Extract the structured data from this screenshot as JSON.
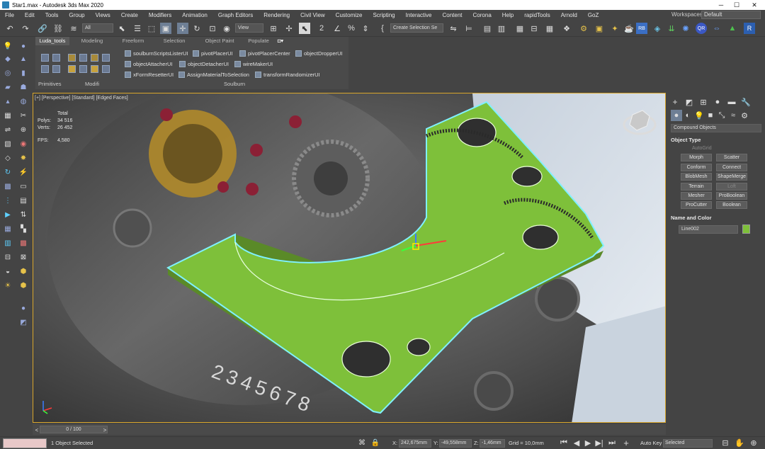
{
  "window": {
    "title": "Star1.max - Autodesk 3ds Max 2020",
    "minimize": "─",
    "maximize": "☐",
    "close": "✕"
  },
  "menu": [
    "File",
    "Edit",
    "Tools",
    "Group",
    "Views",
    "Create",
    "Modifiers",
    "Animation",
    "Graph Editors",
    "Rendering",
    "Civil View",
    "Customize",
    "Scripting",
    "Interactive",
    "Content",
    "Corona",
    "Help",
    "rapidTools",
    "Arnold",
    "GoZ"
  ],
  "workspaces": {
    "label": "Workspaces:",
    "value": "Default"
  },
  "toolbar": {
    "filter": "All",
    "coord_system": "View",
    "selection_set": "Create Selection Se"
  },
  "ribbon": {
    "tabs": [
      "Luda_tools",
      "Modeling",
      "Freeform",
      "Selection",
      "Object Paint",
      "Populate"
    ],
    "active_tab": "Luda_tools",
    "tools": [
      "soulburnScriptsListerUI",
      "pivotPlacerUI",
      "pivotPlacerCenter",
      "objectDropperUI",
      "objectAttacherUI",
      "objectDetacherUI",
      "wireMakerUI",
      "xFormResetterUI",
      "AssignMaterialToSelection",
      "transformRandomizerUI"
    ],
    "footer": {
      "primitives": "Primitives",
      "modifiers": "Modifi",
      "soulburn": "Soulburn"
    }
  },
  "viewport": {
    "label": "[+] [Perspective] [Standard] [Edged Faces]",
    "stats": {
      "header": "Total",
      "polys_label": "Polys:",
      "polys": "34 516",
      "verts_label": "Verts:",
      "verts": "26 452",
      "fps_label": "FPS:",
      "fps": "4,580"
    },
    "watch_numerals": "2345678"
  },
  "command_panel": {
    "category": "Compound Objects",
    "object_type_title": "Object Type",
    "autogrid": "AutoGrid",
    "buttons": [
      "Morph",
      "Scatter",
      "Conform",
      "Connect",
      "BlobMesh",
      "ShapeMerge",
      "Terrain",
      "Loft",
      "Mesher",
      "ProBoolean",
      "ProCutter",
      "Boolean"
    ],
    "disabled": [
      "Loft"
    ],
    "name_color_title": "Name and Color",
    "object_name": "Line002",
    "object_color": "#7ec03a"
  },
  "timeline": {
    "frame": "0 / 100"
  },
  "status": {
    "selected": "1 Object Selected",
    "x_label": "X:",
    "x": "242,675mm",
    "y_label": "Y:",
    "y": "-49,558mm",
    "z_label": "Z:",
    "z": "-1,46mm",
    "grid": "Grid = 10,0mm",
    "autokey": "Auto Key",
    "key_mode": "Selected"
  },
  "colors": {
    "object_green": "#7ec03a",
    "selection_cyan": "#7ff0ff",
    "active_viewport_border": "#d9a62b"
  }
}
